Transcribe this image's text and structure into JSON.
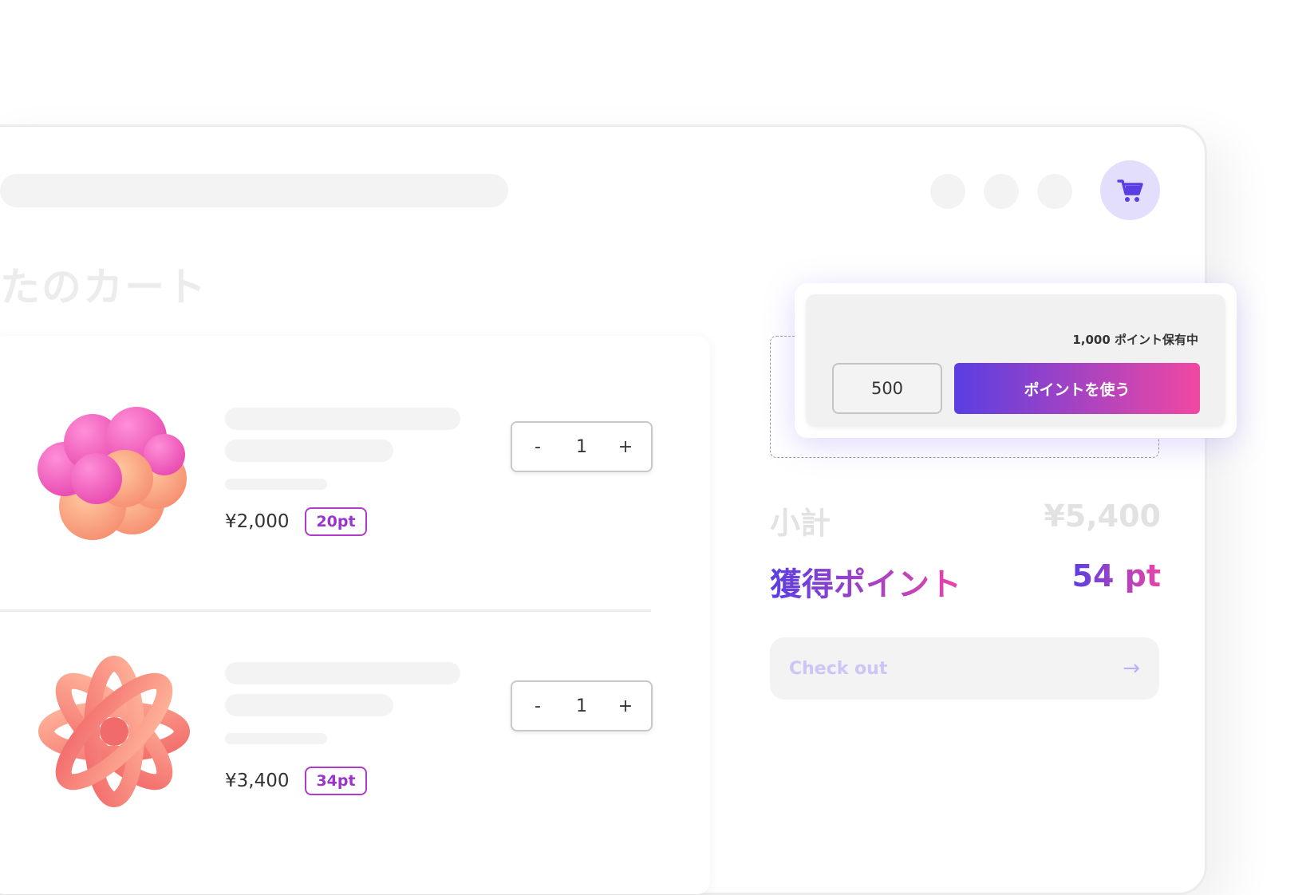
{
  "page": {
    "title": "たのカート"
  },
  "header": {
    "cart_icon": "cart-icon",
    "accent_color": "#5a3ee2"
  },
  "items": [
    {
      "price": "¥2,000",
      "points": "20pt",
      "quantity": "1",
      "decrement_label": "-",
      "increment_label": "+"
    },
    {
      "price": "¥3,400",
      "points": "34pt",
      "quantity": "1",
      "decrement_label": "-",
      "increment_label": "+"
    }
  ],
  "points_popover": {
    "held_text": "1,000 ポイント保有中",
    "input_value": "500",
    "use_button_label": "ポイントを使う"
  },
  "summary": {
    "subtotal_label": "小計",
    "subtotal_value": "¥5,400",
    "earned_label": "獲得ポイント",
    "earned_value": "54 pt"
  },
  "checkout": {
    "label": "Check out",
    "arrow_icon": "arrow-right-icon"
  },
  "colors": {
    "gradient_start": "#5a3ee2",
    "gradient_end": "#f048a2",
    "badge_border": "#b23acb"
  }
}
